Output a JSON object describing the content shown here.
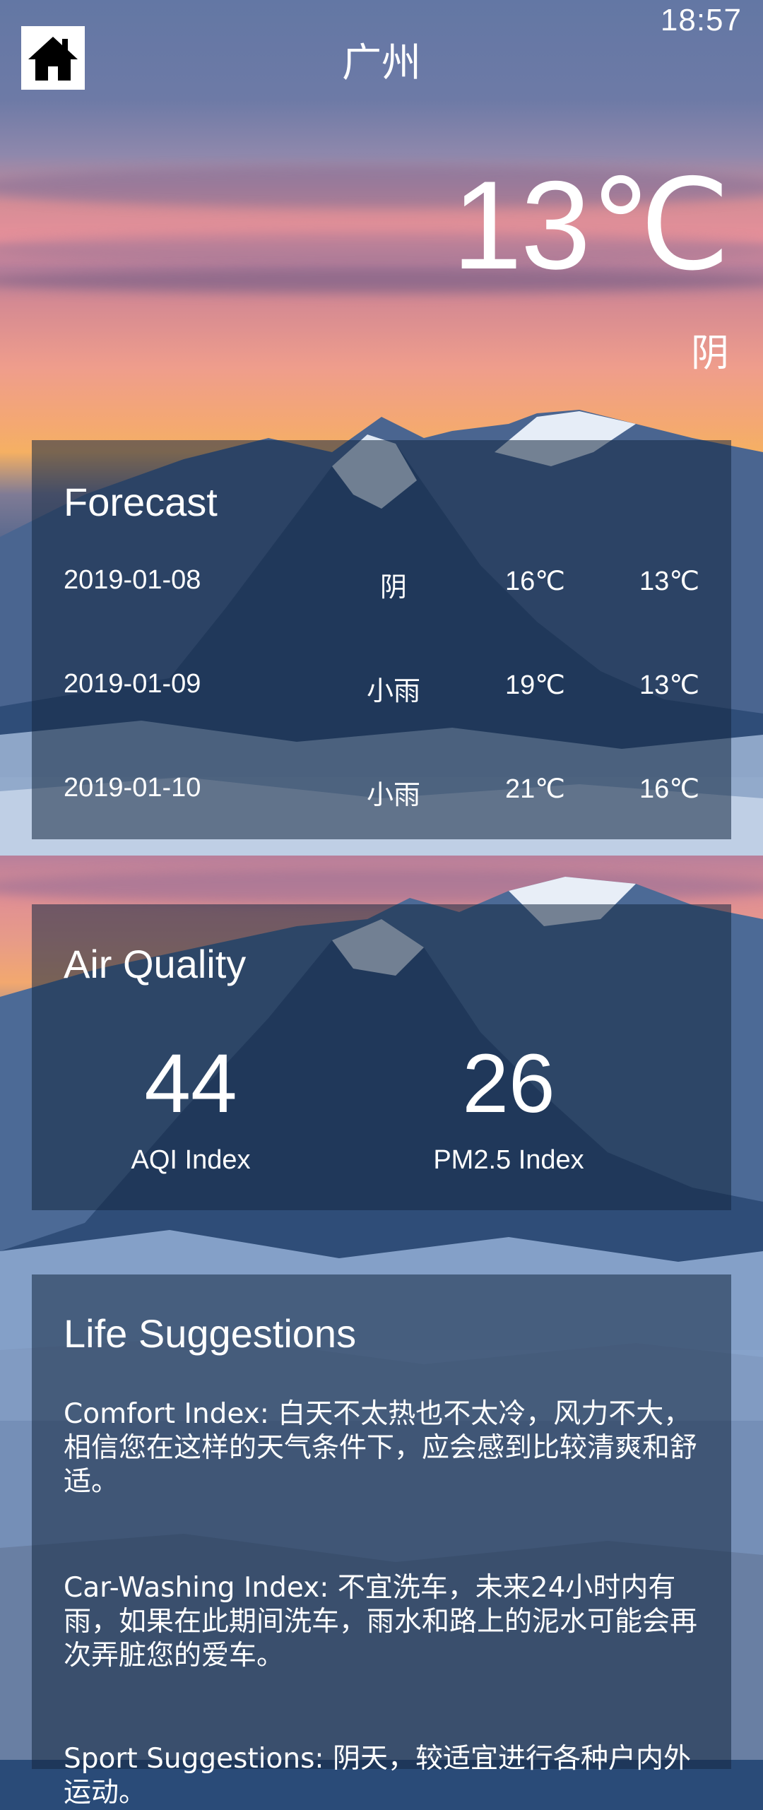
{
  "status_bar": {
    "time": "18:57"
  },
  "header": {
    "city": "广州"
  },
  "now": {
    "temperature": "13℃",
    "condition": "阴"
  },
  "forecast": {
    "title": "Forecast",
    "days": [
      {
        "date": "2019-01-08",
        "condition": "阴",
        "max": "16℃",
        "min": "13℃"
      },
      {
        "date": "2019-01-09",
        "condition": "小雨",
        "max": "19℃",
        "min": "13℃"
      },
      {
        "date": "2019-01-10",
        "condition": "小雨",
        "max": "21℃",
        "min": "16℃"
      }
    ]
  },
  "air_quality": {
    "title": "Air Quality",
    "aqi": {
      "value": "44",
      "label": "AQI Index"
    },
    "pm25": {
      "value": "26",
      "label": "PM2.5 Index"
    }
  },
  "life": {
    "title": "Life Suggestions",
    "comfort": "Comfort Index: 白天不太热也不太冷，风力不大，相信您在这样的天气条件下，应会感到比较清爽和舒适。",
    "car_wash": "Car-Washing Index: 不宜洗车，未来24小时内有雨，如果在此期间洗车，雨水和路上的泥水可能会再次弄脏您的爱车。",
    "sport": "Sport Suggestions: 阴天，较适宜进行各种户内外运动。"
  },
  "icons": {
    "home": "home-icon"
  },
  "colors": {
    "card_overlay": "#142842",
    "text": "#ffffff"
  }
}
